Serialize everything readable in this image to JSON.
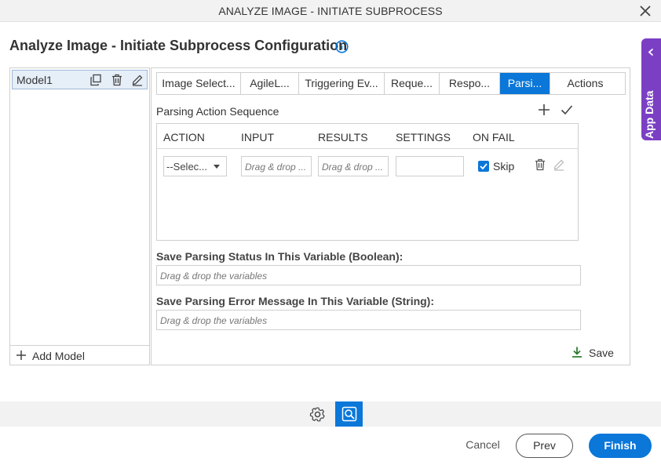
{
  "window": {
    "title": "ANALYZE IMAGE - INITIATE SUBPROCESS"
  },
  "page": {
    "heading": "Analyze Image - Initiate Subprocess Configuration"
  },
  "app_data": {
    "label": "App Data"
  },
  "models": {
    "items": [
      {
        "name": "Model1"
      }
    ],
    "add_label": "Add Model"
  },
  "tabs": [
    {
      "label": "Image Select..."
    },
    {
      "label": "AgileL..."
    },
    {
      "label": "Triggering Ev..."
    },
    {
      "label": "Reque..."
    },
    {
      "label": "Respo..."
    },
    {
      "label": "Parsi...",
      "active": true
    },
    {
      "label": "Actions"
    }
  ],
  "parsing": {
    "section_title": "Parsing Action Sequence",
    "columns": [
      "ACTION",
      "INPUT",
      "RESULTS",
      "SETTINGS",
      "ON FAIL"
    ],
    "row": {
      "action_value": "--Selec...",
      "input_placeholder": "Drag & drop ...",
      "results_placeholder": "Drag & drop ...",
      "settings_value": "",
      "on_fail_label": "Skip",
      "on_fail_checked": true
    },
    "status_label": "Save Parsing Status In This Variable (Boolean):",
    "status_placeholder": "Drag & drop the variables",
    "error_label": "Save Parsing Error Message In This Variable (String):",
    "error_placeholder": "Drag & drop the variables",
    "save_label": "Save"
  },
  "footer": {
    "cancel": "Cancel",
    "prev": "Prev",
    "finish": "Finish"
  },
  "colors": {
    "accent": "#0a77d9",
    "app_data": "#7b3fc4",
    "save_icon": "#2e7d32"
  }
}
